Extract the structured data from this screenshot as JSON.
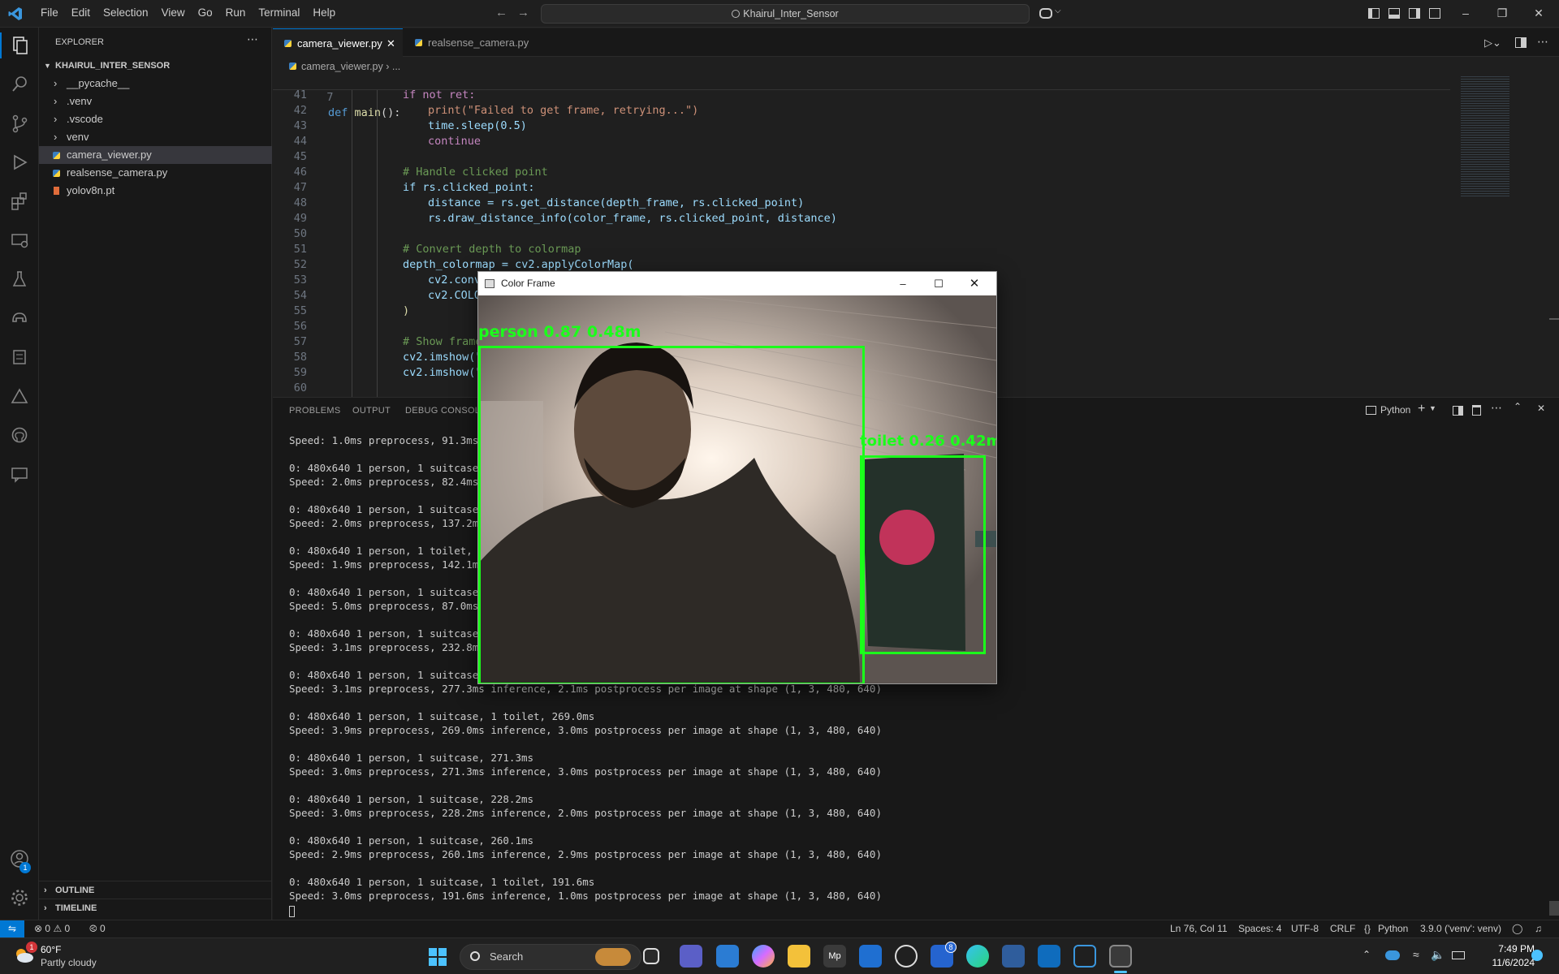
{
  "titlebar": {
    "menu": [
      "File",
      "Edit",
      "Selection",
      "View",
      "Go",
      "Run",
      "Terminal",
      "Help"
    ],
    "search_text": "Khairul_Inter_Sensor"
  },
  "sidebar": {
    "title": "EXPLORER",
    "root": "KHAIRUL_INTER_SENSOR",
    "items": [
      {
        "label": "__pycache__",
        "type": "folder"
      },
      {
        "label": ".venv",
        "type": "folder"
      },
      {
        "label": ".vscode",
        "type": "folder"
      },
      {
        "label": "venv",
        "type": "folder"
      },
      {
        "label": "camera_viewer.py",
        "type": "py",
        "active": true
      },
      {
        "label": "realsense_camera.py",
        "type": "py"
      },
      {
        "label": "yolov8n.pt",
        "type": "pt"
      }
    ],
    "outline": "OUTLINE",
    "timeline": "TIMELINE"
  },
  "tabs": [
    {
      "label": "camera_viewer.py",
      "active": true
    },
    {
      "label": "realsense_camera.py",
      "active": false
    }
  ],
  "breadcrumb": {
    "file": "camera_viewer.py",
    "rest": "..."
  },
  "sticky": {
    "ln": "7",
    "code": "def main():"
  },
  "editor_lines": [
    {
      "ln": "41",
      "code": "if not ret:"
    },
    {
      "ln": "42",
      "code": "print(\"Failed to get frame, retrying...\")"
    },
    {
      "ln": "43",
      "code": "time.sleep(0.5)"
    },
    {
      "ln": "44",
      "code": "continue"
    },
    {
      "ln": "45",
      "code": ""
    },
    {
      "ln": "46",
      "code": "# Handle clicked point"
    },
    {
      "ln": "47",
      "code": "if rs.clicked_point:"
    },
    {
      "ln": "48",
      "code": "distance = rs.get_distance(depth_frame, rs.clicked_point)"
    },
    {
      "ln": "49",
      "code": "rs.draw_distance_info(color_frame, rs.clicked_point, distance)"
    },
    {
      "ln": "50",
      "code": ""
    },
    {
      "ln": "51",
      "code": "# Convert depth to colormap"
    },
    {
      "ln": "52",
      "code": "depth_colormap = cv2.applyColorMap("
    },
    {
      "ln": "53",
      "code": "cv2.conv"
    },
    {
      "ln": "54",
      "code": "cv2.COLO"
    },
    {
      "ln": "55",
      "code": ")"
    },
    {
      "ln": "56",
      "code": ""
    },
    {
      "ln": "57",
      "code": "# Show frame"
    },
    {
      "ln": "58",
      "code": "cv2.imshow(\""
    },
    {
      "ln": "59",
      "code": "cv2.imshow(\""
    },
    {
      "ln": "60",
      "code": ""
    }
  ],
  "panel": {
    "tabs": [
      "PROBLEMS",
      "OUTPUT",
      "DEBUG CONSOLE"
    ],
    "shell": "Python",
    "terminal_lines": [
      "Speed: 1.0ms preprocess, 91.3ms i",
      "",
      "0: 480x640 1 person, 1 suitcase,",
      "Speed: 2.0ms preprocess, 82.4ms i",
      "",
      "0: 480x640 1 person, 1 suitcase,",
      "Speed: 2.0ms preprocess, 137.2ms",
      "",
      "0: 480x640 1 person, 1 toilet, 14",
      "Speed: 1.9ms preprocess, 142.1ms",
      "",
      "0: 480x640 1 person, 1 suitcase,",
      "Speed: 5.0ms preprocess, 87.0ms i",
      "",
      "0: 480x640 1 person, 1 suitcase,",
      "Speed: 3.1ms preprocess, 232.8ms",
      "",
      "0: 480x640 1 person, 1 suitcase,",
      "Speed: 3.1ms preprocess, 277.3ms inference, 2.1ms postprocess per image at shape (1, 3, 480, 640)",
      "",
      "0: 480x640 1 person, 1 suitcase, 1 toilet, 269.0ms",
      "Speed: 3.9ms preprocess, 269.0ms inference, 3.0ms postprocess per image at shape (1, 3, 480, 640)",
      "",
      "0: 480x640 1 person, 1 suitcase, 271.3ms",
      "Speed: 3.0ms preprocess, 271.3ms inference, 3.0ms postprocess per image at shape (1, 3, 480, 640)",
      "",
      "0: 480x640 1 person, 1 suitcase, 228.2ms",
      "Speed: 3.0ms preprocess, 228.2ms inference, 2.0ms postprocess per image at shape (1, 3, 480, 640)",
      "",
      "0: 480x640 1 person, 1 suitcase, 260.1ms",
      "Speed: 2.9ms preprocess, 260.1ms inference, 2.9ms postprocess per image at shape (1, 3, 480, 640)",
      "",
      "0: 480x640 1 person, 1 suitcase, 1 toilet, 191.6ms",
      "Speed: 3.0ms preprocess, 191.6ms inference, 1.0ms postprocess per image at shape (1, 3, 480, 640)"
    ]
  },
  "popup": {
    "title": "Color Frame",
    "person_label": "person 0.87 0.48m",
    "flag_label": "toilet 0.26 0.42m"
  },
  "statusbar": {
    "errors": "0",
    "warnings": "0",
    "ports": "0",
    "position": "Ln 76, Col 11",
    "spaces": "Spaces: 4",
    "encoding": "UTF-8",
    "eol": "CRLF",
    "language": "Python",
    "interpreter": "3.9.0 ('venv': venv)"
  },
  "taskbar": {
    "weather_temp": "60°F",
    "weather_desc": "Partly cloudy",
    "weather_badge": "1",
    "search": "Search",
    "time": "7:49 PM",
    "date": "11/6/2024",
    "badge_8": "8"
  },
  "colors": {
    "accent": "#0078d4",
    "detection": "#1bff1b"
  }
}
